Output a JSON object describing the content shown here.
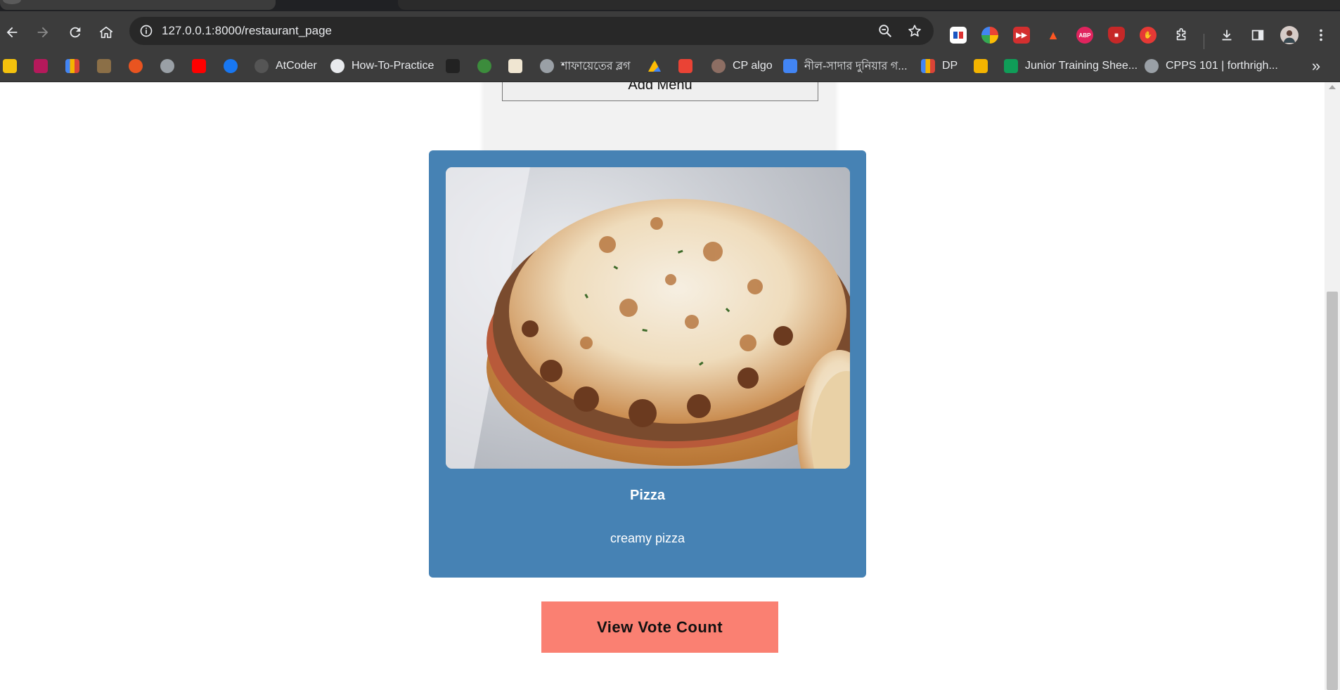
{
  "browser": {
    "url": "127.0.0.1:8000/restaurant_page",
    "bookmarks": [
      {
        "label": "",
        "color": "#f4c20d",
        "icon": "smiley-icon"
      },
      {
        "label": "",
        "color": "#b5195b",
        "icon": "uva-icon"
      },
      {
        "label": "",
        "color": "#4285f4",
        "icon": "bar-chart-icon"
      },
      {
        "label": "",
        "color": "#8b6f47",
        "icon": "codechef-icon"
      },
      {
        "label": "",
        "color": "#e95420",
        "icon": "ubuntu-icon"
      },
      {
        "label": "",
        "color": "#9aa0a6",
        "icon": "globe-icon"
      },
      {
        "label": "",
        "color": "#ff0000",
        "icon": "youtube-icon"
      },
      {
        "label": "",
        "color": "#1877f2",
        "icon": "facebook-icon"
      },
      {
        "label": "AtCoder",
        "color": "#555555",
        "icon": "atcoder-icon"
      },
      {
        "label": "How-To-Practice",
        "color": "#e8eaed",
        "icon": "github-icon"
      },
      {
        "label": "",
        "color": "#222222",
        "icon": "ninja-icon"
      },
      {
        "label": "",
        "color": "#3c8c3c",
        "icon": "leaf-icon"
      },
      {
        "label": "",
        "color": "#f0e6d2",
        "icon": "person-icon"
      },
      {
        "label": "শাফায়েতের ব্লগ",
        "color": "#9aa0a6",
        "icon": "globe-icon"
      },
      {
        "label": "",
        "color": "#34a853",
        "icon": "drive-icon"
      },
      {
        "label": "",
        "color": "#ea4335",
        "icon": "gmail-icon"
      },
      {
        "label": "CP algo",
        "color": "#8d6e63",
        "icon": "cp-algo-icon"
      },
      {
        "label": "নীল-সাদার দুনিয়ার গ...",
        "color": "#4285f4",
        "icon": "docs-icon"
      },
      {
        "label": "DP",
        "color": "#4285f4",
        "icon": "bar-chart-icon"
      },
      {
        "label": "",
        "color": "#f4b400",
        "icon": "slides-icon"
      },
      {
        "label": "Junior Training Shee...",
        "color": "#0f9d58",
        "icon": "sheets-icon"
      },
      {
        "label": "CPPS 101 | forthrigh...",
        "color": "#9aa0a6",
        "icon": "globe-icon"
      }
    ]
  },
  "page": {
    "add_menu_label": "Add Menu",
    "dish": {
      "name": "Pizza",
      "description": "creamy pizza",
      "image": "pizza-photo"
    },
    "vote_button_label": "View Vote Count"
  },
  "colors": {
    "card": "#4682b4",
    "vote_button": "#fa8072",
    "toolbar": "#3c3c3c"
  }
}
